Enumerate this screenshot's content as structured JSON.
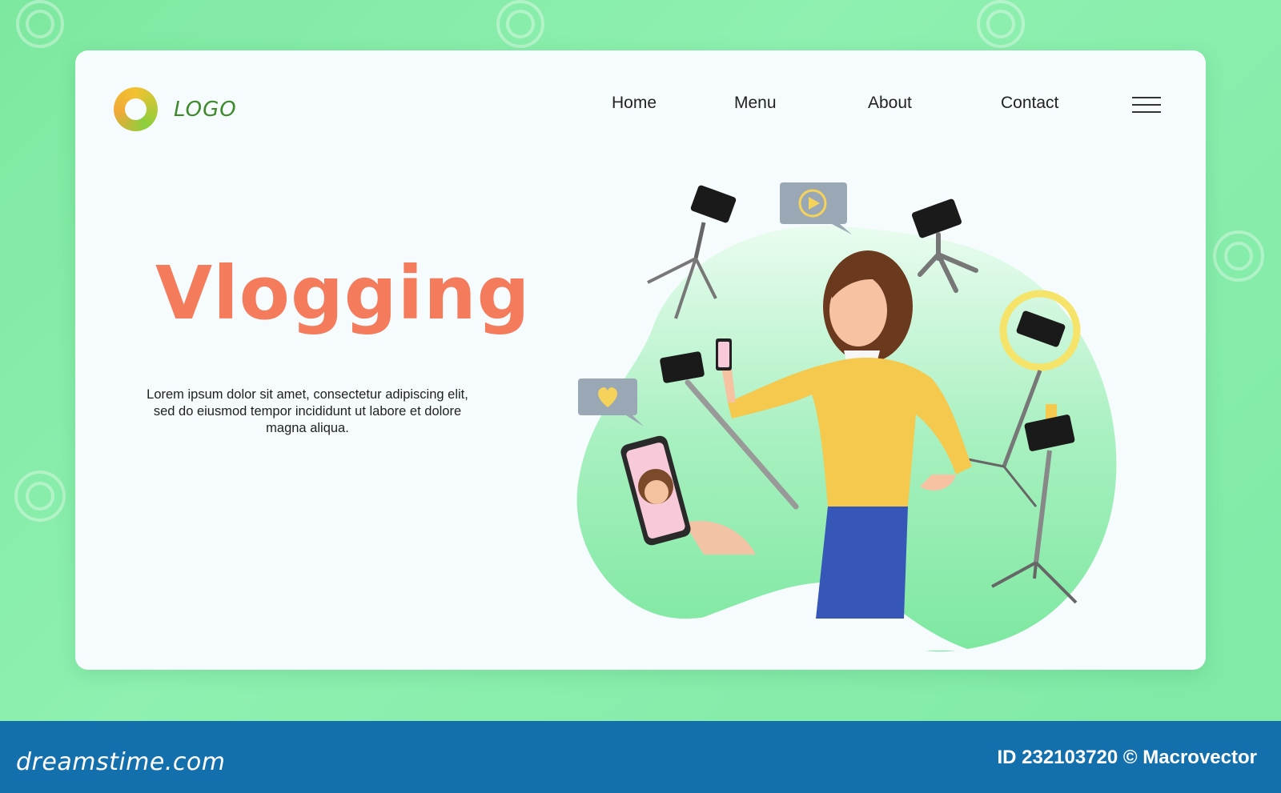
{
  "logo": {
    "text": "LOGO"
  },
  "nav": {
    "items": [
      {
        "label": "Home"
      },
      {
        "label": "Menu"
      },
      {
        "label": "About"
      },
      {
        "label": "Contact"
      }
    ],
    "menu_icon": "hamburger-icon"
  },
  "hero": {
    "title": "Vlogging",
    "description": "Lorem ipsum dolor sit amet, consectetur adipiscing elit, sed do eiusmod tempor incididunt ut labore et dolore magna aliqua."
  },
  "footer": {
    "brand": "dreamstime.com",
    "id_text": "ID 232103720 © Macrovector"
  },
  "colors": {
    "background": "#7de8a0",
    "card": "#f6fcfd",
    "title": "#f47b5c",
    "footer": "#1370ad",
    "logo_text": "#3f8a2c"
  }
}
